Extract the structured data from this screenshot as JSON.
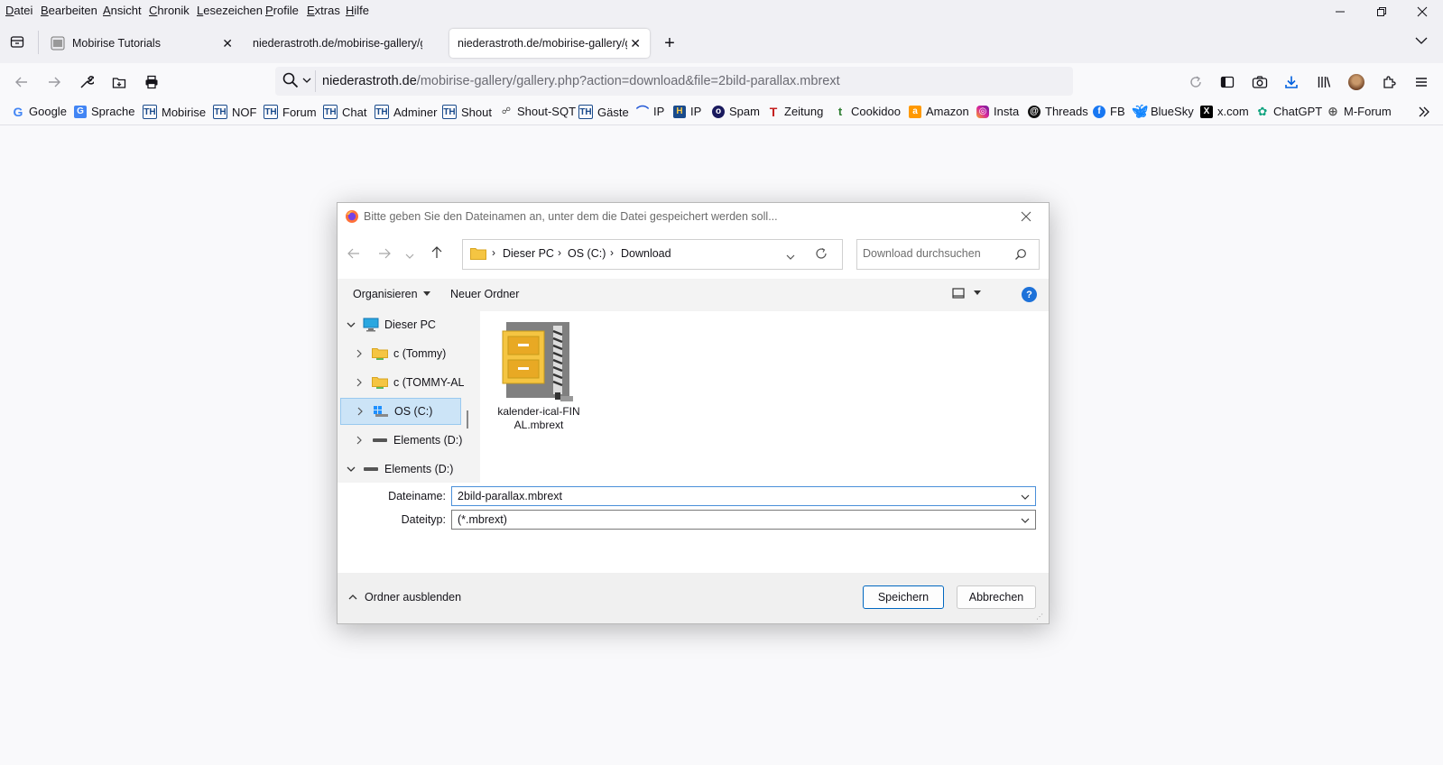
{
  "menubar": {
    "items": [
      {
        "accel": "D",
        "rest": "atei"
      },
      {
        "accel": "B",
        "rest": "earbeiten"
      },
      {
        "accel": "A",
        "rest": "nsicht"
      },
      {
        "accel": "C",
        "rest": "hronik"
      },
      {
        "accel": "L",
        "rest": "esezeichen"
      },
      {
        "accel": "P",
        "rest": "rofile"
      },
      {
        "accel": "E",
        "rest": "xtras"
      },
      {
        "accel": "H",
        "rest": "ilfe"
      }
    ]
  },
  "tabs": [
    {
      "title": "Mobirise Tutorials",
      "active": false
    },
    {
      "title": "niederastroth.de/mobirise-gallery/g",
      "active": false
    },
    {
      "title": "niederastroth.de/mobirise-gallery/g",
      "active": true
    }
  ],
  "urlbar": {
    "host": "niederastroth.de",
    "path": "/mobirise-gallery/gallery.php?action=download&file=2bild-parallax.mbrext"
  },
  "bookmarks": [
    {
      "label": "Google",
      "icon": "google-icon",
      "color": "#4285f4"
    },
    {
      "label": "Sprache",
      "icon": "translate-icon",
      "color": "#4285f4"
    },
    {
      "label": "Mobirise",
      "icon": "th-icon",
      "color": "#1a4b8c"
    },
    {
      "label": "NOF",
      "icon": "th-icon",
      "color": "#1a4b8c"
    },
    {
      "label": "Forum",
      "icon": "th-icon",
      "color": "#1a4b8c"
    },
    {
      "label": "Chat",
      "icon": "th-icon",
      "color": "#1a4b8c"
    },
    {
      "label": "Adminer",
      "icon": "th-icon",
      "color": "#1a4b8c"
    },
    {
      "label": "Shout",
      "icon": "th-icon",
      "color": "#1a4b8c"
    },
    {
      "label": "Shout-SQT",
      "icon": "shout-sqt-icon",
      "color": "#444444"
    },
    {
      "label": "Gäste",
      "icon": "th-icon",
      "color": "#1a4b8c"
    },
    {
      "label": "IP",
      "icon": "ip-arc-icon",
      "color": "#2257d6"
    },
    {
      "label": "IP",
      "icon": "ip-box-icon",
      "color": "#1a4b8c"
    },
    {
      "label": "Spam",
      "icon": "spam-icon",
      "color": "#1a1a5e"
    },
    {
      "label": "Zeitung",
      "icon": "zeitung-icon",
      "color": "#c41e1e"
    },
    {
      "label": "Cookidoo",
      "icon": "cookidoo-icon",
      "color": "#2e7d32"
    },
    {
      "label": "Amazon",
      "icon": "amazon-icon",
      "color": "#ff9900"
    },
    {
      "label": "Insta",
      "icon": "instagram-icon",
      "color": "#d6249f"
    },
    {
      "label": "Threads",
      "icon": "threads-icon",
      "color": "#111111"
    },
    {
      "label": "FB",
      "icon": "facebook-icon",
      "color": "#1877f2"
    },
    {
      "label": "BlueSky",
      "icon": "bluesky-icon",
      "color": "#1185fe"
    },
    {
      "label": "x.com",
      "icon": "x-icon",
      "color": "#000000"
    },
    {
      "label": "ChatGPT",
      "icon": "chatgpt-icon",
      "color": "#10a37f"
    },
    {
      "label": "M-Forum",
      "icon": "globe-icon",
      "color": "#555555"
    }
  ],
  "dialog": {
    "title": "Bitte geben Sie den Dateinamen an, unter dem die Datei gespeichert werden soll...",
    "breadcrumb": [
      "Dieser PC",
      "OS (C:)",
      "Download"
    ],
    "search_placeholder": "Download durchsuchen",
    "organize_label": "Organisieren",
    "new_folder_label": "Neuer Ordner",
    "tree": [
      {
        "label": "Dieser PC",
        "expanded": true,
        "icon": "computer-icon"
      },
      {
        "label": "c (Tommy)",
        "expanded": false,
        "icon": "network-folder-icon"
      },
      {
        "label": "c (TOMMY-AL",
        "expanded": false,
        "icon": "network-folder-icon"
      },
      {
        "label": "OS (C:)",
        "expanded": false,
        "icon": "windows-drive-icon",
        "selected": true
      },
      {
        "label": "Elements (D:)",
        "expanded": false,
        "icon": "drive-icon"
      },
      {
        "label": "Elements (D:)",
        "expanded": true,
        "icon": "drive-icon"
      }
    ],
    "files": [
      {
        "name": "kalender-ical-FINAL.mbrext",
        "name_line1": "kalender-ical-FIN",
        "name_line2": "AL.mbrext",
        "icon": "archive-file-icon"
      }
    ],
    "filename_label": "Dateiname:",
    "filename_value": "2bild-parallax.mbrext",
    "filetype_label": "Dateityp:",
    "filetype_value": "(*.mbrext)",
    "hide_folders_label": "Ordner ausblenden",
    "save_label": "Speichern",
    "cancel_label": "Abbrechen"
  }
}
